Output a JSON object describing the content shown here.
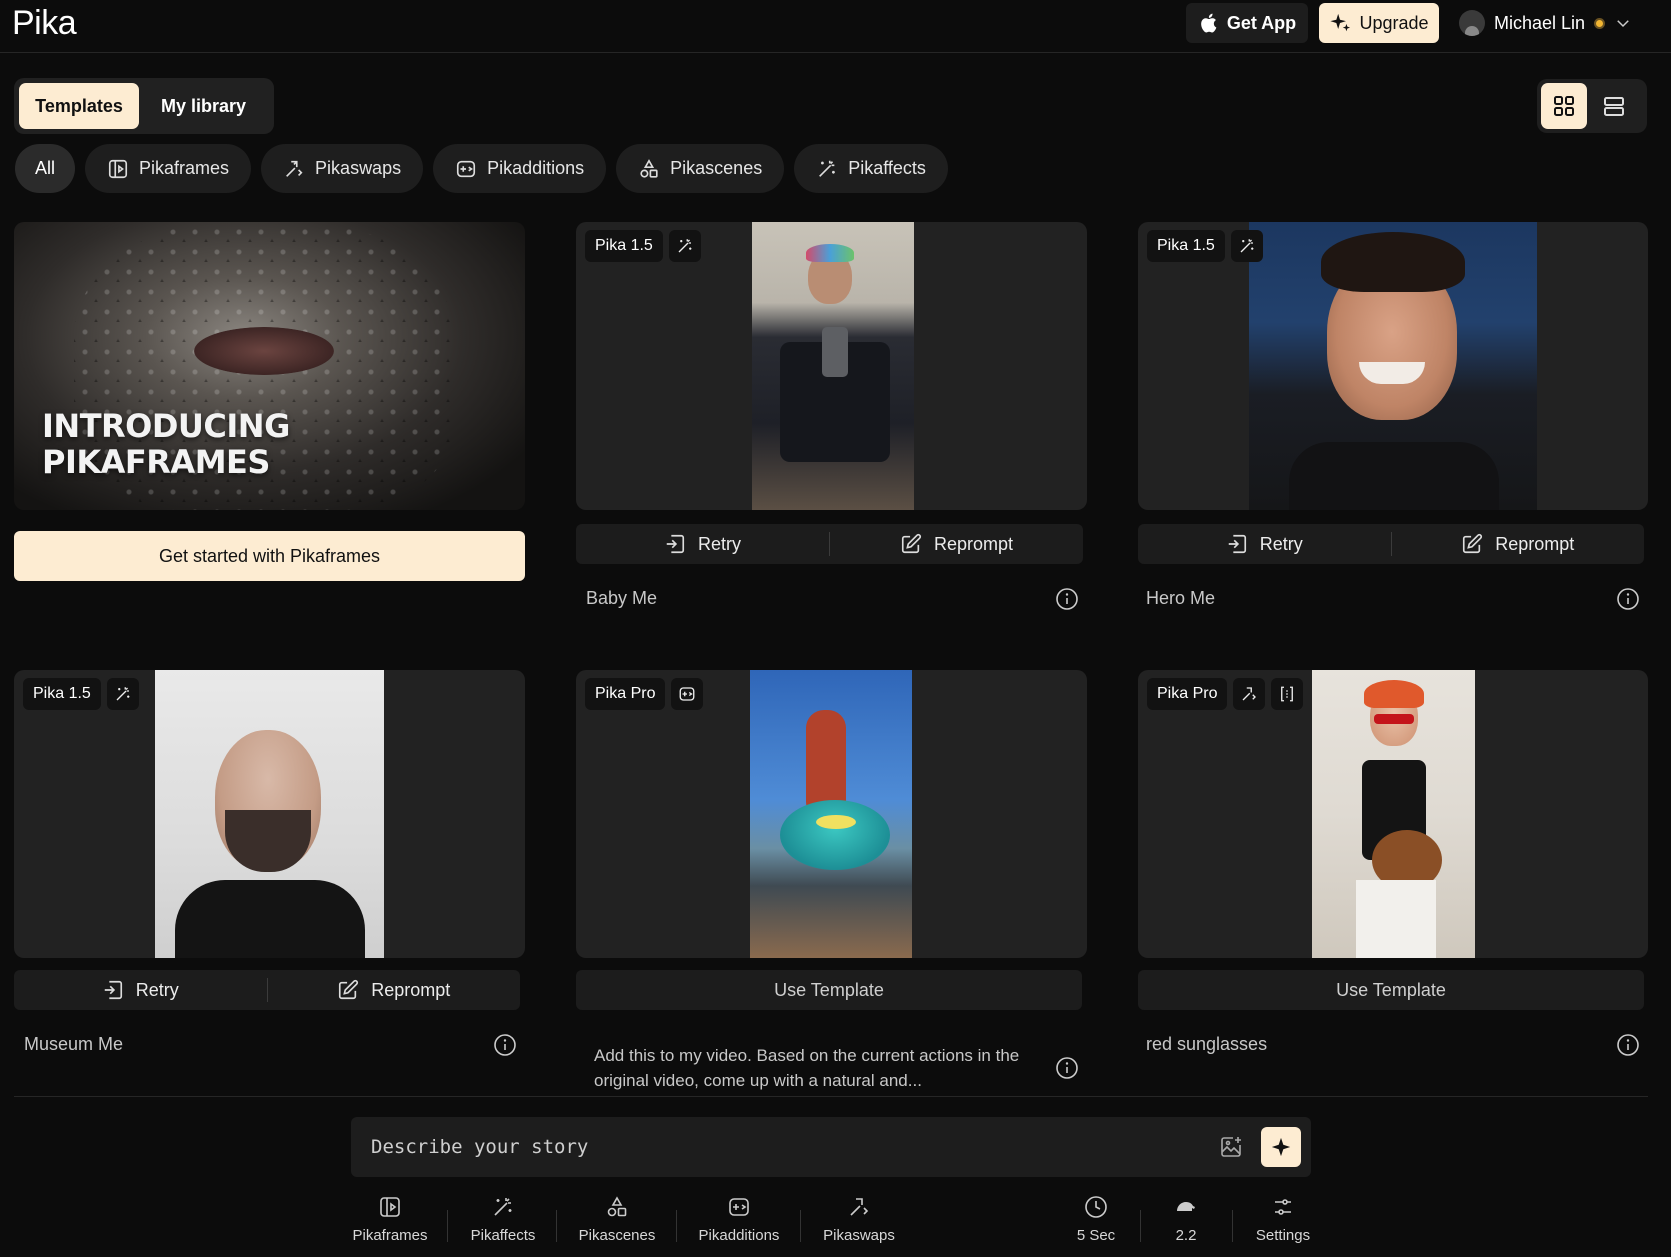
{
  "header": {
    "logo": "Pika",
    "get_app": "Get App",
    "upgrade": "Upgrade",
    "user_name": "Michael Lin"
  },
  "library_tabs": [
    "Templates",
    "My library"
  ],
  "filters": [
    "All",
    "Pikaframes",
    "Pikaswaps",
    "Pikadditions",
    "Pikascenes",
    "Pikaffects"
  ],
  "promo": {
    "headline_line1": "INTRODUCING",
    "headline_line2": "PIKAFRAMES",
    "button": "Get started with Pikaframes"
  },
  "cards": [
    {
      "model": "Pika 1.5",
      "title": "Baby Me",
      "retry": "Retry",
      "reprompt": "Reprompt"
    },
    {
      "model": "Pika 1.5",
      "title": "Hero Me",
      "retry": "Retry",
      "reprompt": "Reprompt"
    },
    {
      "model": "Pika 1.5",
      "title": "Museum Me",
      "retry": "Retry",
      "reprompt": "Reprompt"
    },
    {
      "model": "Pika Pro",
      "action": "Use Template",
      "title": "Add this to my video. Based on the current actions in the original video, come up with a natural and..."
    },
    {
      "model": "Pika Pro",
      "action": "Use Template",
      "title": "red sunglasses"
    }
  ],
  "prompt": {
    "placeholder": "Describe your story"
  },
  "toolbar": {
    "pikaframes": "Pikaframes",
    "pikaffects": "Pikaffects",
    "pikascenes": "Pikascenes",
    "pikadditions": "Pikadditions",
    "pikaswaps": "Pikaswaps",
    "duration": "5 Sec",
    "model": "2.2",
    "settings": "Settings"
  },
  "colors": {
    "background": "#0c0c0c",
    "accent": "#fdecd2",
    "surface": "#1d1d1d",
    "status_dot": "#f2b632"
  }
}
